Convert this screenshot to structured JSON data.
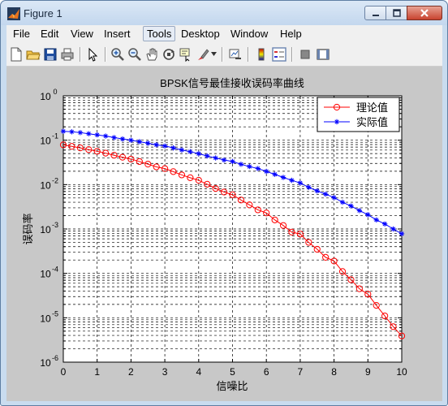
{
  "window": {
    "title": "Figure 1"
  },
  "menu": [
    "File",
    "Edit",
    "View",
    "Insert",
    "Tools",
    "Desktop",
    "Window",
    "Help"
  ],
  "toolbar_icons": [
    "new-figure-icon",
    "open-file-icon",
    "save-icon",
    "print-icon",
    "edit-plot-arrow-icon",
    "zoom-in-icon",
    "zoom-out-icon",
    "pan-icon",
    "rotate-3d-icon",
    "data-cursor-icon",
    "brush-icon",
    "link-plot-icon",
    "colorbar-icon",
    "legend-icon",
    "hide-plot-tools-icon",
    "show-plot-tools-icon"
  ],
  "chart_data": {
    "type": "line",
    "title": "BPSK信号最佳接收误码率曲线",
    "xlabel": "信噪比",
    "ylabel": "误码率",
    "xlim": [
      0,
      10
    ],
    "ylim": [
      1e-06,
      1
    ],
    "yscale": "log",
    "grid": true,
    "legend_position": "top-right",
    "x_ticks": [
      "0",
      "1",
      "2",
      "3",
      "4",
      "5",
      "6",
      "7",
      "8",
      "9",
      "10"
    ],
    "y_tick_base": "10",
    "y_tick_exponents": [
      "0",
      "-1",
      "-2",
      "-3",
      "-4",
      "-5",
      "-6"
    ],
    "x": [
      0,
      0.25,
      0.5,
      0.75,
      1,
      1.25,
      1.5,
      1.75,
      2,
      2.25,
      2.5,
      2.75,
      3,
      3.25,
      3.5,
      3.75,
      4,
      4.25,
      4.5,
      4.75,
      5,
      5.25,
      5.5,
      5.75,
      6,
      6.25,
      6.5,
      6.75,
      7,
      7.25,
      7.5,
      7.75,
      8,
      8.25,
      8.5,
      8.75,
      9,
      9.25,
      9.5,
      9.75,
      10
    ],
    "series": [
      {
        "name": "理论值",
        "color": "#ff0000",
        "marker": "circle",
        "values": [
          0.0786,
          0.0726,
          0.0671,
          0.0614,
          0.0563,
          0.0511,
          0.0458,
          0.0414,
          0.0375,
          0.0331,
          0.0289,
          0.0251,
          0.0229,
          0.0196,
          0.0165,
          0.0143,
          0.0125,
          0.0102,
          0.0082,
          0.0068,
          0.0059,
          0.0045,
          0.0035,
          0.0027,
          0.0023,
          0.0016,
          0.0012,
          0.00085,
          0.00077,
          0.0005,
          0.00035,
          0.00023,
          0.00019,
          0.00011,
          7.2e-05,
          4.5e-05,
          3.4e-05,
          1.9e-05,
          1.1e-05,
          6.3e-06,
          3.9e-06
        ]
      },
      {
        "name": "实际值",
        "color": "#0000ff",
        "marker": "star",
        "values": [
          0.1587,
          0.1547,
          0.1483,
          0.1398,
          0.1318,
          0.1241,
          0.1147,
          0.1066,
          0.1,
          0.0926,
          0.0855,
          0.0786,
          0.0741,
          0.067,
          0.0602,
          0.0551,
          0.0497,
          0.0442,
          0.0398,
          0.0358,
          0.0332,
          0.0287,
          0.0255,
          0.023,
          0.0198,
          0.017,
          0.0145,
          0.0125,
          0.0109,
          0.0087,
          0.0072,
          0.0061,
          0.0051,
          0.004,
          0.0033,
          0.0026,
          0.0021,
          0.0016,
          0.0013,
          0.001,
          0.00078
        ]
      }
    ]
  }
}
